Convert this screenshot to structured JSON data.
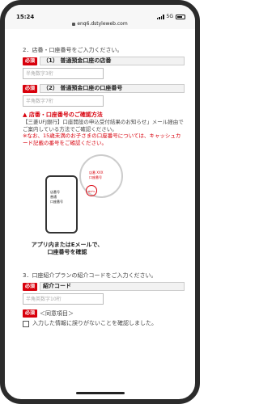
{
  "status": {
    "time": "15:24",
    "network": "5G"
  },
  "browser": {
    "url": "enq6.dstyleweb.com"
  },
  "section2": {
    "question": "2．店番・口座番号をご入力ください。",
    "branch": {
      "required": "必須",
      "label": "（1） 普通預金口座の店番",
      "placeholder": "半角数字3桁"
    },
    "account": {
      "required": "必須",
      "label": "（2） 普通預金口座の口座番号",
      "placeholder": "半角数字7桁"
    },
    "notice": {
      "title": "▲ 店番・口座番号のご確認方法",
      "body": "【三菱UFJ銀行】口座開設の申込受付結果のお知らせ」メール経由でご案内している方法でご確認ください。",
      "warning": "※なお、15歳未満のお子さまの口座番号については、キャッシュカード記載の番号をご確認ください。"
    },
    "illustration": {
      "phone_text": "店番号\n普通\n口座番号",
      "mag_text": "店番 XXX\n口座番号",
      "bank_logo": "MUFG",
      "caption": "アプリ内またはEメールで、\n口座番号を確認"
    }
  },
  "section3": {
    "question": "3．口座紹介プランの紹介コードをご入力ください。",
    "code": {
      "required": "必須",
      "label": "紹介コード",
      "placeholder": "半角英数字10桁"
    }
  },
  "agreement": {
    "required": "必須",
    "title": "＜同意項目＞",
    "checkbox_label": "入力した情報に誤りがないことを確認しました。"
  }
}
